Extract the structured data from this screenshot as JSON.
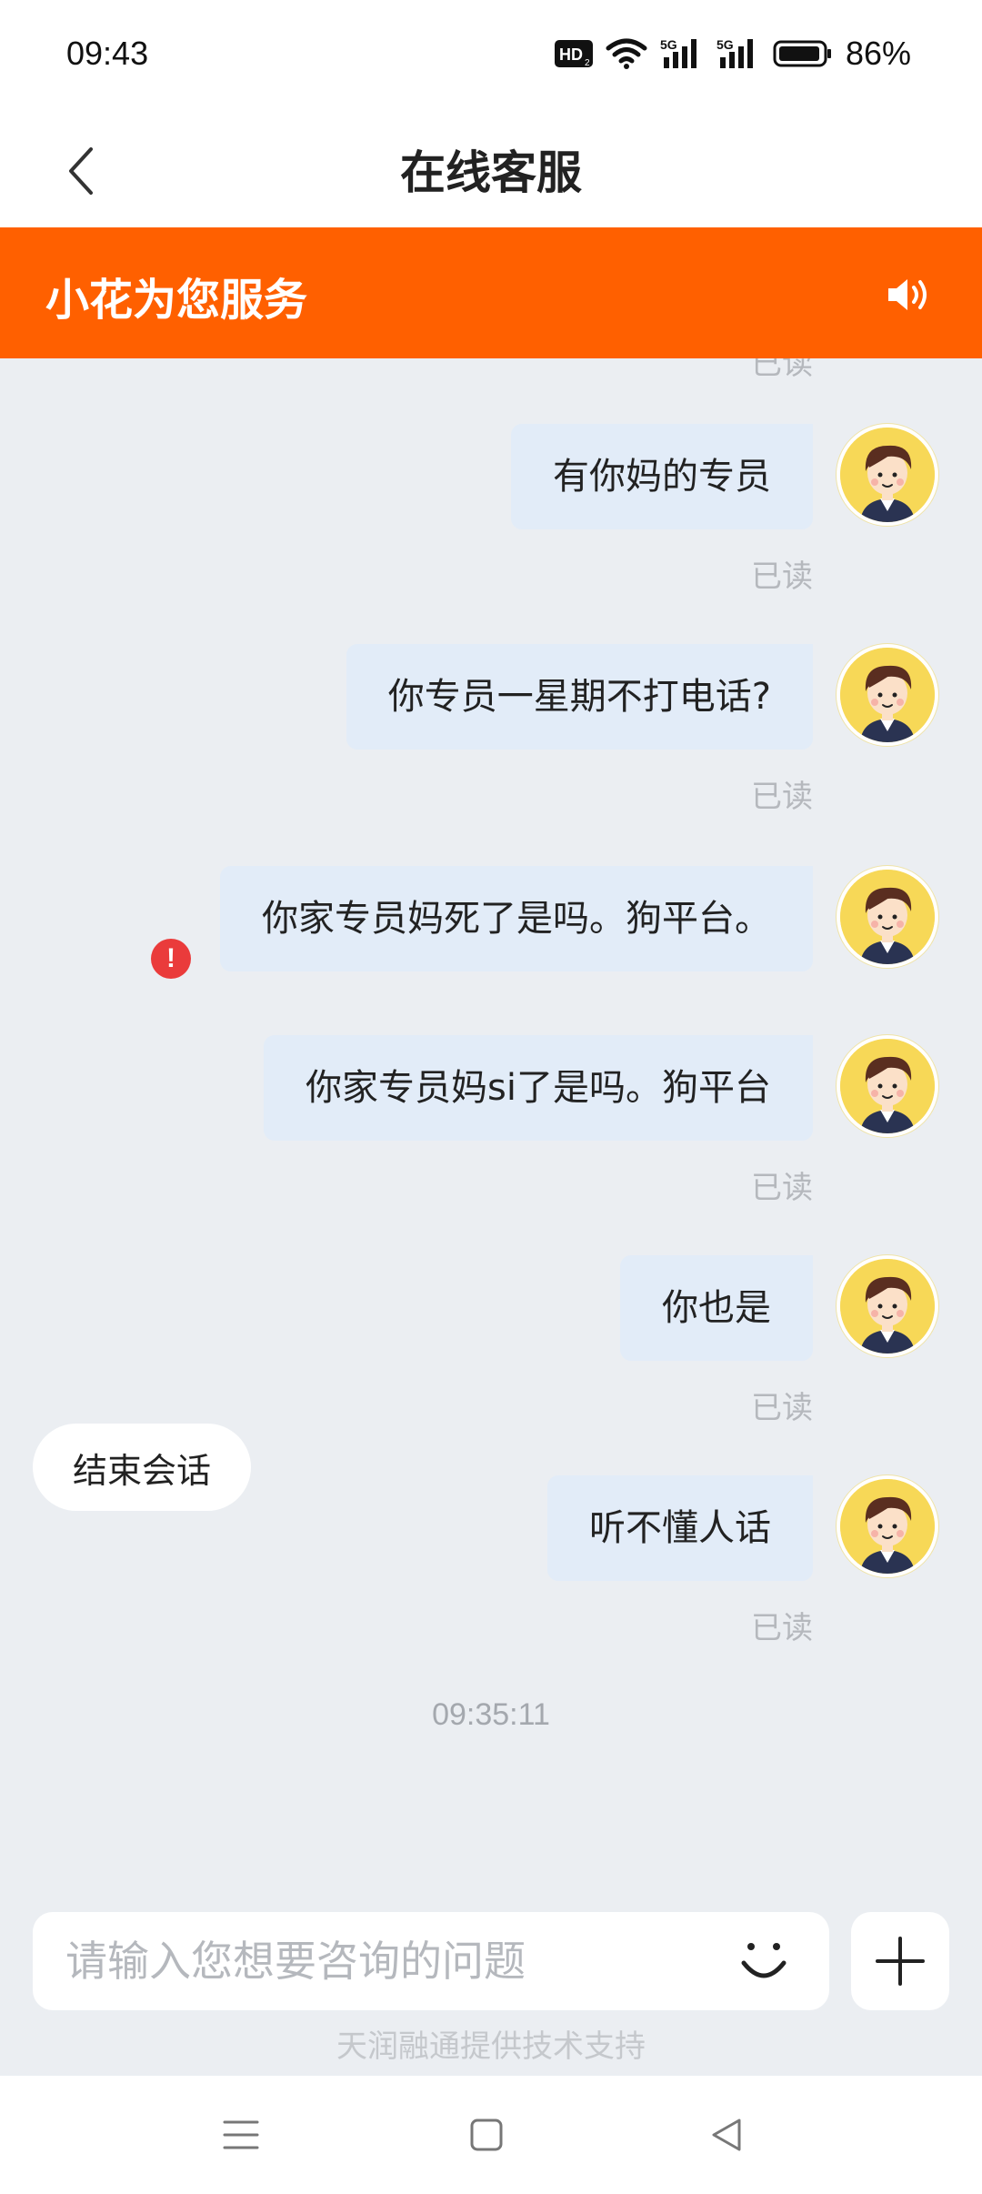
{
  "status_bar": {
    "time": "09:43",
    "battery": "86%",
    "network_1": "5G",
    "network_2": "5G",
    "hd_badge": "HD"
  },
  "header": {
    "title": "在线客服",
    "back_icon": "chevron-left-icon"
  },
  "banner": {
    "agent": "小花为您服务",
    "speaker_icon": "speaker-icon",
    "color": "#ff6000"
  },
  "chat": {
    "partial_read": "已读",
    "messages": [
      {
        "text": "有你妈的专员",
        "status": "已读"
      },
      {
        "text": "你专员一星期不打电话?",
        "status": "已读"
      },
      {
        "text": "你家专员妈死了是吗。狗平台。",
        "status": "",
        "error_mark": "!"
      },
      {
        "text": "你家专员妈si了是吗。狗平台",
        "status": "已读"
      },
      {
        "text": "你也是",
        "status": "已读"
      },
      {
        "text": "听不懂人话",
        "status": "已读"
      }
    ],
    "timestamp": "09:35:11",
    "end_session_label": "结束会话"
  },
  "input": {
    "placeholder": "请输入您想要咨询的问题",
    "value": ""
  },
  "footer": {
    "powered_by": "天润融通提供技术支持"
  },
  "colors": {
    "bubble": "#e2ecf8",
    "background": "#ebeef2",
    "error": "#ea3b3b",
    "avatar_bg": "#f7d857"
  }
}
